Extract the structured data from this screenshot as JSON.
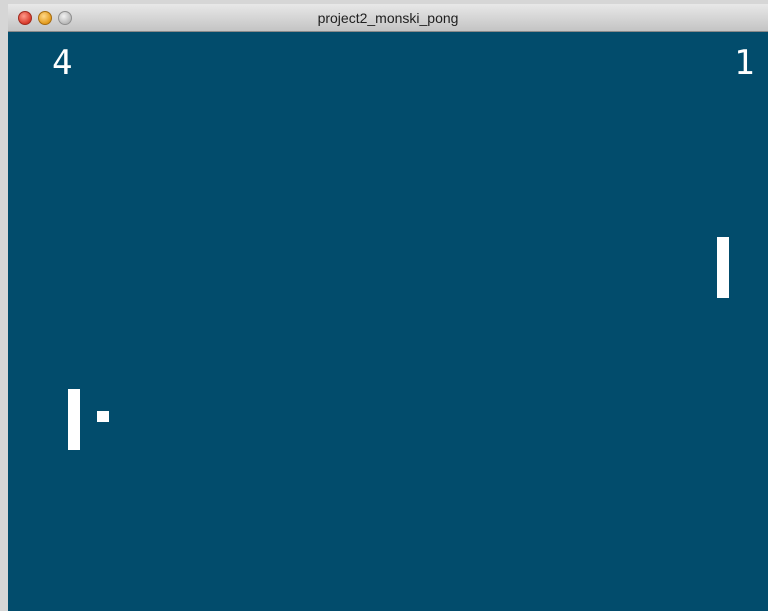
{
  "window": {
    "title": "project2_monski_pong"
  },
  "game": {
    "score_left": "4",
    "score_right": "1"
  },
  "colors": {
    "background": "#024c6c",
    "foreground": "#ffffff"
  },
  "icons": {
    "close": "close-button-icon",
    "minimize": "minimize-button-icon",
    "zoom": "zoom-button-icon"
  }
}
